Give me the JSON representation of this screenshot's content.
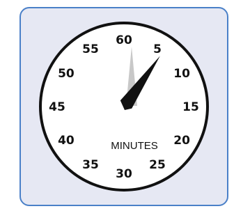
{
  "timer": {
    "unit_label": "MINUTES",
    "minute_numbers": [
      "60",
      "5",
      "10",
      "15",
      "20",
      "25",
      "30",
      "35",
      "40",
      "45",
      "50",
      "55"
    ],
    "set_minutes": 5
  },
  "colors": {
    "frame_border": "#4a80c8",
    "frame_background": "#e6e8f3",
    "dial_face": "#ffffff",
    "dial_rim": "#111111",
    "pointer_dark": "#111111",
    "pointer_light": "#c8c8c8"
  }
}
